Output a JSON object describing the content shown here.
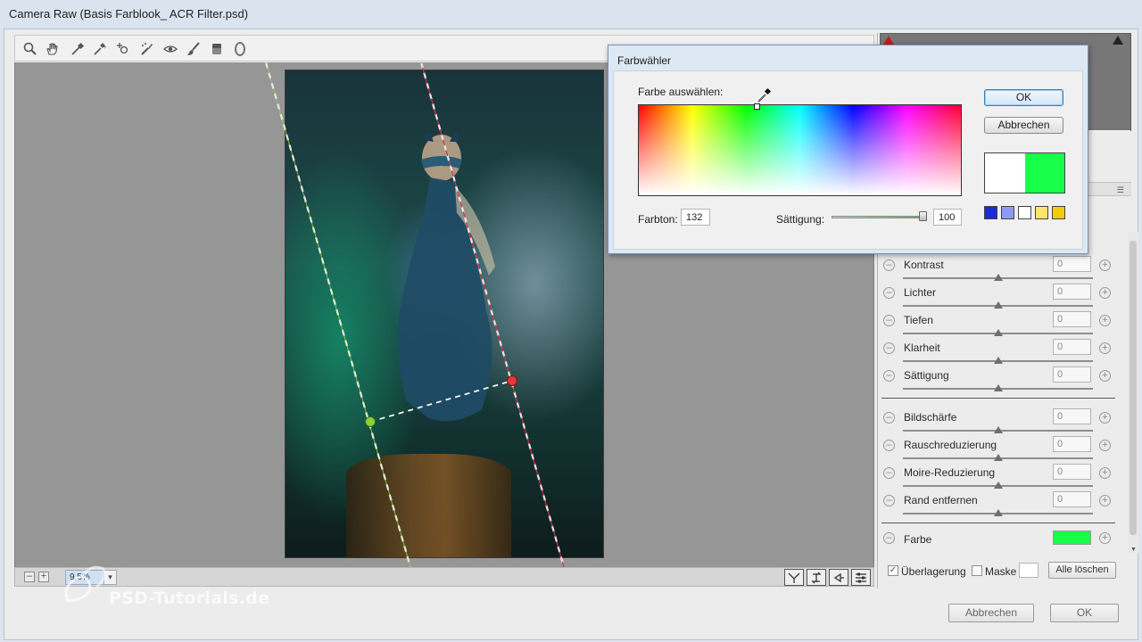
{
  "window": {
    "title": "Camera Raw (Basis Farblook_ ACR Filter.psd)"
  },
  "toolbar": {
    "tools": [
      {
        "name": "zoom-tool-icon"
      },
      {
        "name": "hand-tool-icon"
      },
      {
        "name": "white-balance-tool-icon"
      },
      {
        "name": "color-sampler-tool-icon"
      },
      {
        "name": "targeted-adjustment-tool-icon"
      },
      {
        "name": "spot-removal-tool-icon"
      },
      {
        "name": "red-eye-tool-icon"
      },
      {
        "name": "adjustment-brush-icon"
      },
      {
        "name": "graduated-filter-icon"
      },
      {
        "name": "radial-filter-icon"
      }
    ]
  },
  "statusbar": {
    "zoom_minus": "–",
    "zoom_plus": "+",
    "zoom_value": "9,5%",
    "zoom_dropdown": "▾"
  },
  "watermark": {
    "text": "PSD-Tutorials.de"
  },
  "adjustments": [
    {
      "label": "Kontrast",
      "value": "0",
      "slider_fraction": 0.5
    },
    {
      "label": "Lichter",
      "value": "0",
      "slider_fraction": 0.5
    },
    {
      "label": "Tiefen",
      "value": "0",
      "slider_fraction": 0.5
    },
    {
      "label": "Klarheit",
      "value": "0",
      "slider_fraction": 0.5
    },
    {
      "label": "Sättigung",
      "value": "0",
      "slider_fraction": 0.5
    },
    {
      "label": "Bildschärfe",
      "value": "0",
      "slider_fraction": 0.5
    },
    {
      "label": "Rauschreduzierung",
      "value": "0",
      "slider_fraction": 0.5
    },
    {
      "label": "Moire-Reduzierung",
      "value": "0",
      "slider_fraction": 0.5
    },
    {
      "label": "Rand entfernen",
      "value": "0",
      "slider_fraction": 0.5
    }
  ],
  "farbe": {
    "label": "Farbe",
    "color": "#18ff4a"
  },
  "options": {
    "overlay_label": "Überlagerung",
    "overlay_checked": true,
    "overlay_check": "✓",
    "mask_label": "Maske",
    "mask_checked": false,
    "clear_all": "Alle löschen"
  },
  "footer": {
    "cancel": "Abbrechen",
    "ok": "OK"
  },
  "color_picker": {
    "title": "Farbwähler",
    "select_label": "Farbe auswählen:",
    "hue_label": "Farbton:",
    "hue_value": "132",
    "saturation_label": "Sättigung:",
    "saturation_value": "100",
    "ok": "OK",
    "cancel": "Abbrechen",
    "old_color": "#ffffff",
    "new_color": "#18ff4a",
    "presets": [
      "#1a2bd9",
      "#8b9bf2",
      "#ffffff",
      "#ffe46b",
      "#f2cc0c"
    ]
  },
  "colors": {
    "green_line": "#8fd13c",
    "red_line": "#d6334a"
  }
}
